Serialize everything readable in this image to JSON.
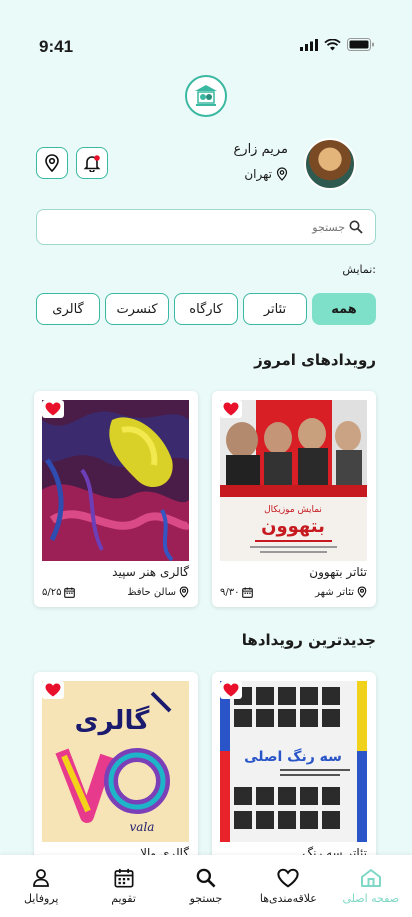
{
  "status": {
    "time": "9:41"
  },
  "user": {
    "name": "مریم زارع",
    "city": "تهران"
  },
  "search": {
    "placeholder": "جستجو"
  },
  "filter": {
    "label": "نمایش:",
    "chips": [
      "همه",
      "تئاتر",
      "کارگاه",
      "کنسرت",
      "گالری"
    ],
    "active": "همه"
  },
  "sections": {
    "today": {
      "title": "رویدادهای امروز",
      "cards": [
        {
          "title": "تئاتر بتهوون",
          "venue": "تئاتر شهر",
          "date": "۹/۳۰",
          "poster_text": "بتهوون",
          "poster_sub": "نمایش موزیکال"
        },
        {
          "title": "گالری هنر سپید",
          "venue": "سالن حافظ",
          "date": "۵/۲۵"
        }
      ]
    },
    "newest": {
      "title": "جدیدترین رویدادها",
      "cards": [
        {
          "title": "تئاتر سه رنگ",
          "poster_text": "سه رنگ اصلی"
        },
        {
          "title": "گالری والا",
          "poster_text": "گالری",
          "poster_sub": "vala"
        }
      ]
    }
  },
  "nav": {
    "items": [
      "صفحه اصلی",
      "علاقه‌مندی‌ها",
      "جستجو",
      "تقویم",
      "پروفایل"
    ],
    "active": "صفحه اصلی"
  },
  "colors": {
    "accent": "#3bb8a2",
    "active_chip": "#7fe0c9",
    "heart": "#e8102a",
    "background": "#eafaf8"
  }
}
